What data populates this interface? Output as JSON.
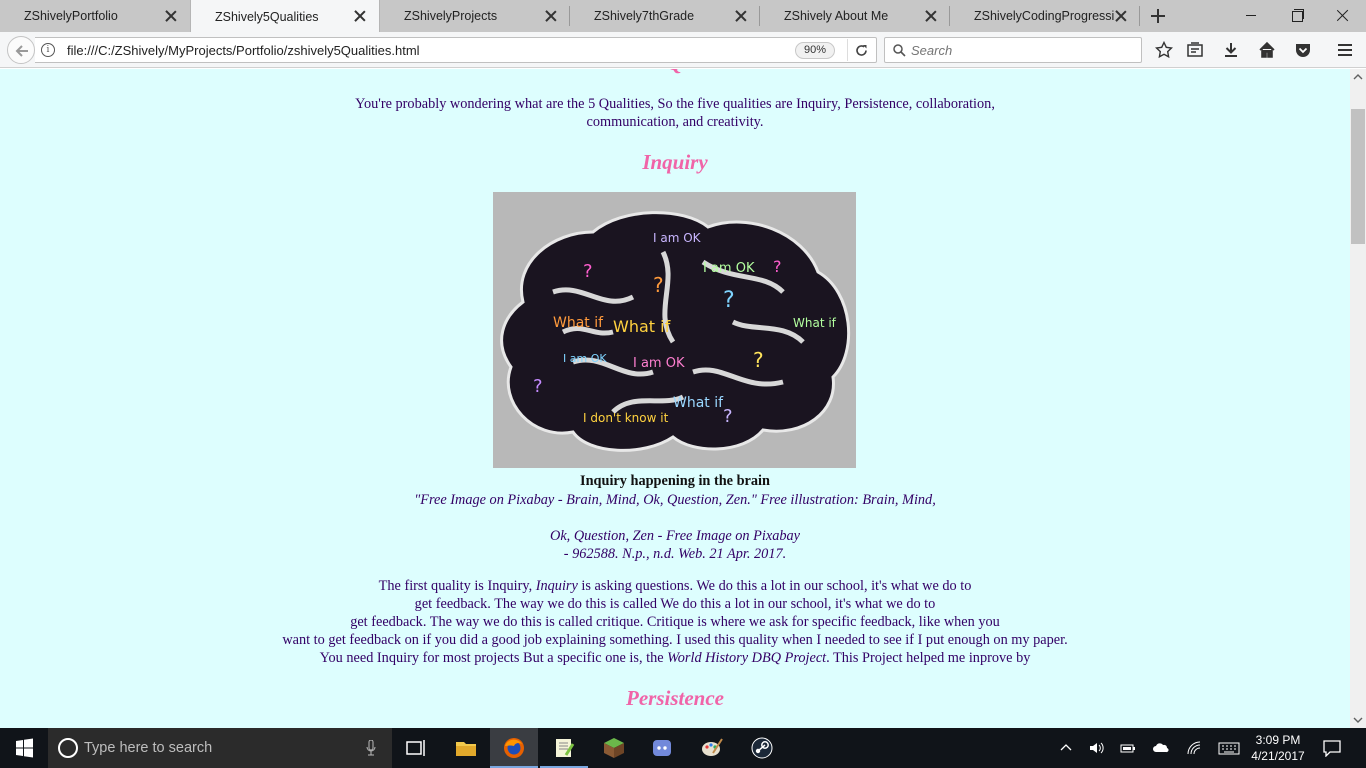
{
  "browser": {
    "tabs": [
      {
        "title": "ZShivelyPortfolio",
        "active": false
      },
      {
        "title": "ZShively5Qualities",
        "active": true
      },
      {
        "title": "ZShivelyProjects",
        "active": false
      },
      {
        "title": "ZShively7thGrade",
        "active": false
      },
      {
        "title": "ZShively About Me",
        "active": false
      },
      {
        "title": "ZShivelyCodingProgression",
        "active": false
      }
    ],
    "url": "file:///C:/ZShively/MyProjects/Portfolio/zshively5Qualities.html",
    "zoom": "90%",
    "search_placeholder": "Search",
    "toolbar_icons": [
      "star-icon",
      "reading-list-icon",
      "download-icon",
      "home-icon",
      "pocket-icon",
      "hamburger-menu-icon"
    ]
  },
  "page": {
    "intro": [
      "You're probably wondering what are the 5 Qualities, So the five qualities are Inquiry, Persistence, collaboration,",
      "communication, and creativity."
    ],
    "inquiry_heading": "Inquiry",
    "image_caption": "Inquiry happening in the brain",
    "citation": [
      "\"Free Image on Pixabay - Brain, Mind, Ok, Question, Zen.\" Free illustration: Brain, Mind,",
      "",
      "Ok, Question, Zen - Free Image on Pixabay",
      "- 962588. N.p., n.d. Web. 21 Apr. 2017."
    ],
    "inquiry_text": {
      "l1_a": "The first quality is Inquiry, ",
      "l1_em": "Inquiry",
      "l1_b": " is asking questions. We do this a lot in our school, it's what we do to",
      "l2": "get feedback. The way we do this is called We do this a lot in our school, it's what we do to",
      "l3": "get feedback. The way we do this is called critique. Critique is where we ask for specific feedback, like when you",
      "l4": "want to get feedback on if you did a good job explaining something. I used this quality when I needed to see if I put enough on my paper.",
      "l5_a": "You need Inquiry for most projects But a specific one is, the ",
      "l5_em": "World History DBQ Project",
      "l5_b": ". This Project helped me inprove by"
    },
    "persistence_heading": "Persistence",
    "background_color": "#ddfefe",
    "heading_color": "#f064a8",
    "text_color": "#330066"
  },
  "taskbar": {
    "search_placeholder": "Type here to search",
    "pinned_apps": [
      "task-view-icon",
      "file-explorer-icon",
      "firefox-icon",
      "notepad-plus-plus-icon",
      "minecraft-icon",
      "discord-icon",
      "paint-icon",
      "steam-icon"
    ],
    "clock_time": "3:09 PM",
    "clock_date": "4/21/2017"
  }
}
